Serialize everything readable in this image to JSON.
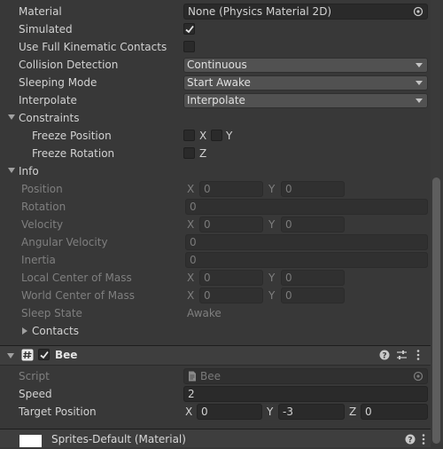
{
  "rigidbody": {
    "material": {
      "label": "Material",
      "value": "None (Physics Material 2D)"
    },
    "simulated": {
      "label": "Simulated",
      "checked": true
    },
    "kinematic_contacts": {
      "label": "Use Full Kinematic Contacts",
      "checked": false
    },
    "collision_detection": {
      "label": "Collision Detection",
      "value": "Continuous"
    },
    "sleeping_mode": {
      "label": "Sleeping Mode",
      "value": "Start Awake"
    },
    "interpolate": {
      "label": "Interpolate",
      "value": "Interpolate"
    },
    "constraints": {
      "label": "Constraints",
      "freeze_position": {
        "label": "Freeze Position",
        "x": "X",
        "y": "Y"
      },
      "freeze_rotation": {
        "label": "Freeze Rotation",
        "z": "Z"
      }
    },
    "info": {
      "label": "Info",
      "position": {
        "label": "Position",
        "x": "0",
        "y": "0"
      },
      "rotation": {
        "label": "Rotation",
        "value": "0"
      },
      "velocity": {
        "label": "Velocity",
        "x": "0",
        "y": "0"
      },
      "angular_velocity": {
        "label": "Angular Velocity",
        "value": "0"
      },
      "inertia": {
        "label": "Inertia",
        "value": "0"
      },
      "local_center_of_mass": {
        "label": "Local Center of Mass",
        "x": "0",
        "y": "0"
      },
      "world_center_of_mass": {
        "label": "World Center of Mass",
        "x": "0",
        "y": "0"
      },
      "sleep_state": {
        "label": "Sleep State",
        "value": "Awake"
      },
      "contacts": {
        "label": "Contacts"
      }
    },
    "axis": {
      "x": "X",
      "y": "Y",
      "z": "Z"
    }
  },
  "bee": {
    "title": "Bee",
    "enabled": true,
    "script": {
      "label": "Script",
      "value": "Bee"
    },
    "speed": {
      "label": "Speed",
      "value": "2"
    },
    "target_position": {
      "label": "Target Position",
      "x": "0",
      "y": "-3",
      "z": "0"
    }
  },
  "material_section": {
    "title": "Sprites-Default (Material)"
  },
  "icons": {
    "object_picker": "target-circle-icon",
    "checkmark": "checkmark-icon",
    "help": "help-icon",
    "presets": "sliders-icon",
    "menu": "kebab-menu-icon",
    "script": "script-file-icon"
  },
  "colors": {
    "background": "#383838",
    "field": "#2a2a2a",
    "dropdown": "#515151",
    "text": "#d2d2d2",
    "disabled_text": "#7f7f7f"
  }
}
